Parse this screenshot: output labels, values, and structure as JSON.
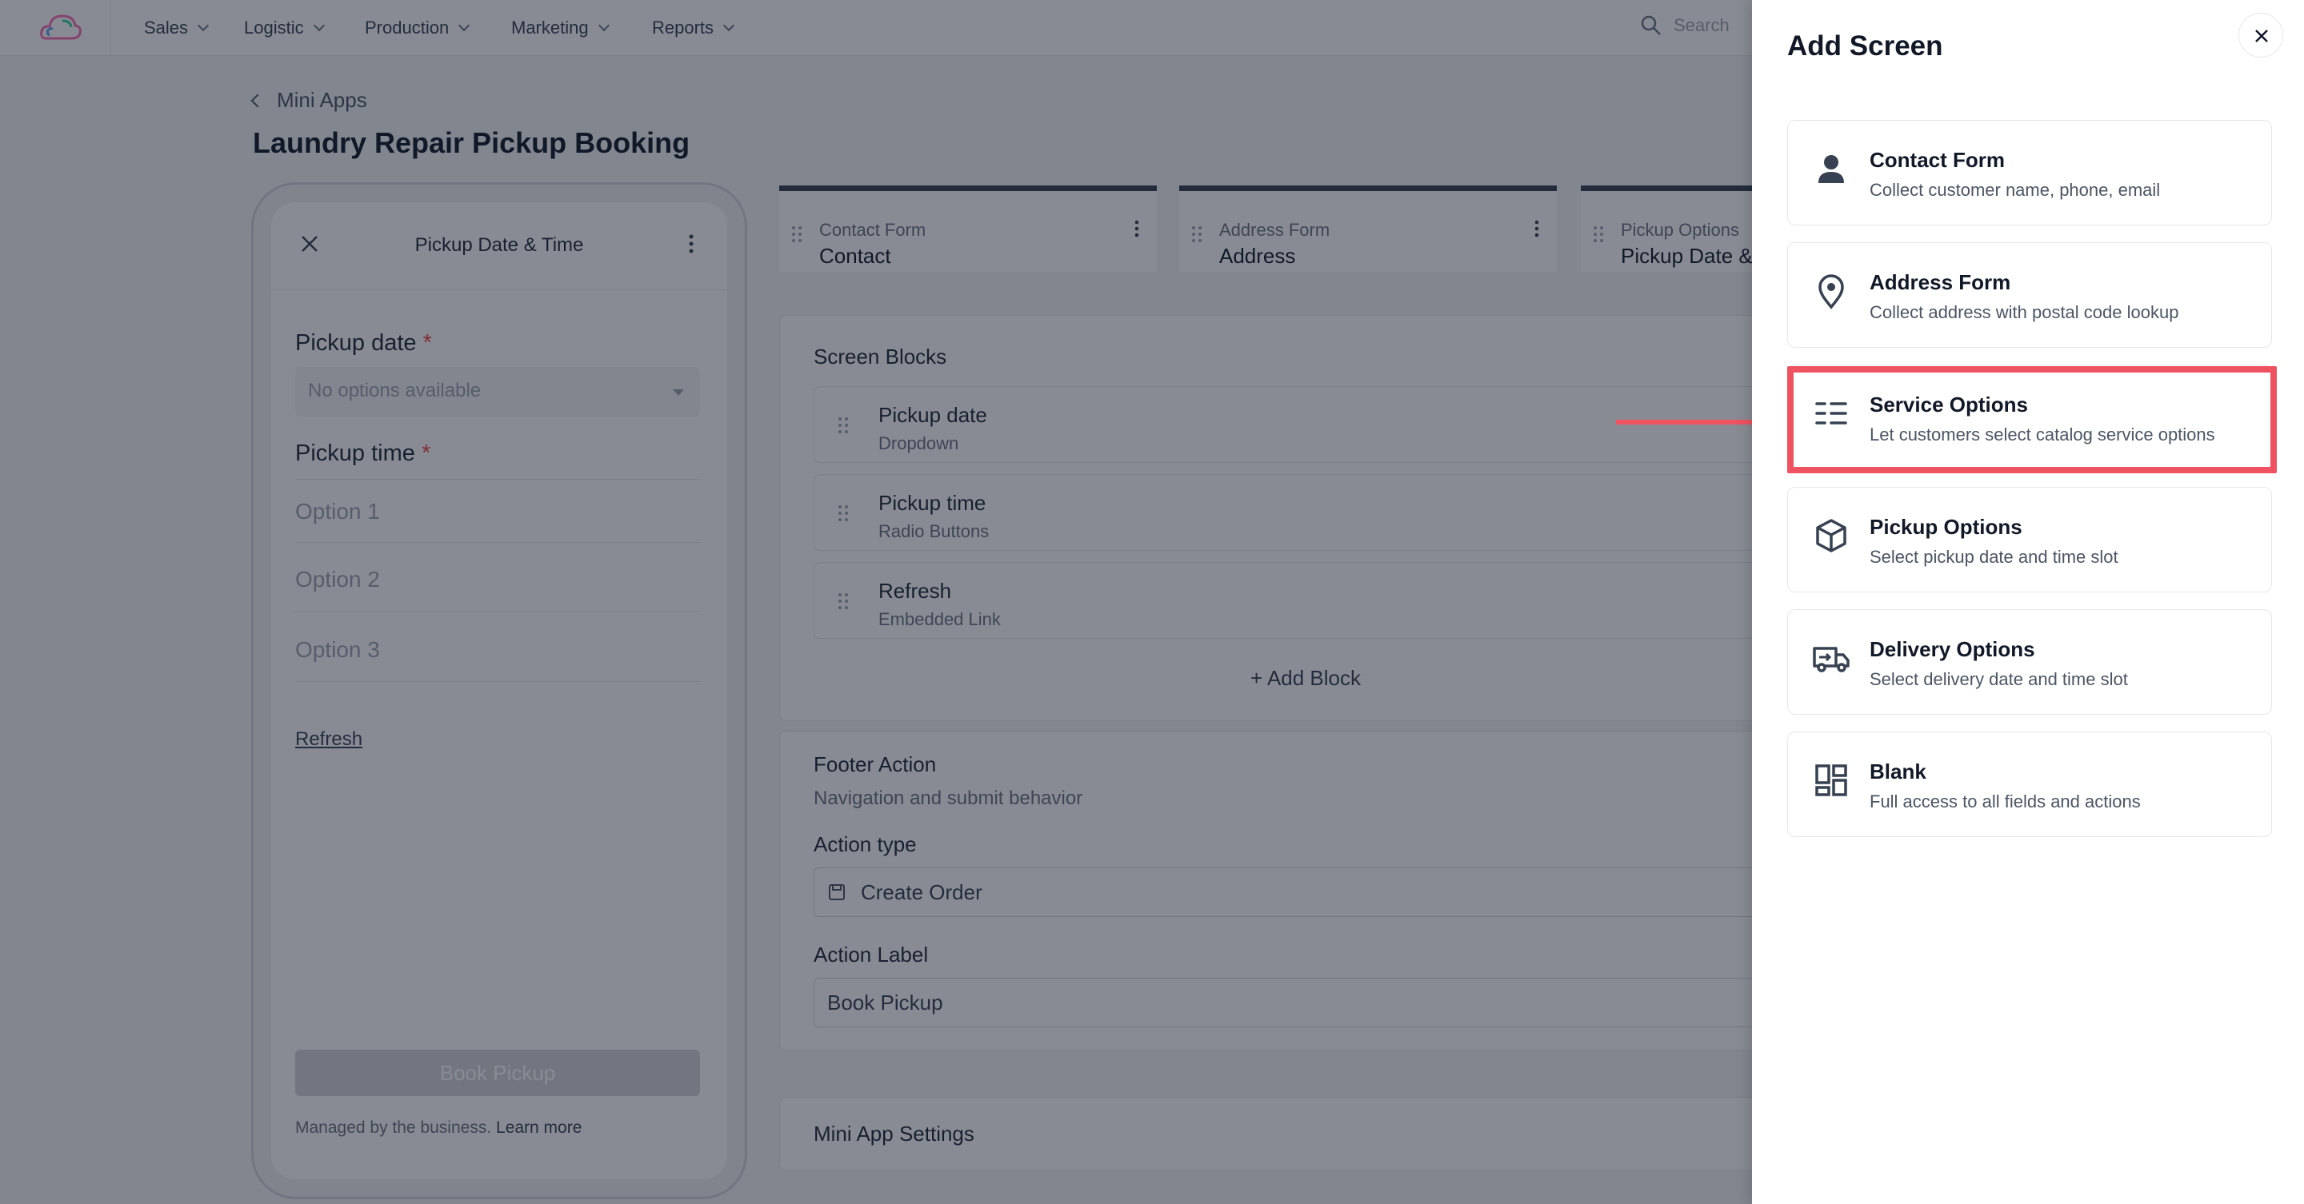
{
  "topnav": {
    "items": [
      {
        "label": "Sales"
      },
      {
        "label": "Logistic"
      },
      {
        "label": "Production"
      },
      {
        "label": "Marketing"
      },
      {
        "label": "Reports"
      }
    ],
    "search_placeholder": "Search"
  },
  "breadcrumb": {
    "label": "Mini Apps"
  },
  "page": {
    "title": "Laundry Repair Pickup Booking"
  },
  "phone": {
    "header_title": "Pickup Date & Time",
    "pickup_date_label": "Pickup date",
    "required_mark": "*",
    "pickup_date_placeholder": "No options available",
    "pickup_time_label": "Pickup time",
    "options": [
      "Option 1",
      "Option 2",
      "Option 3"
    ],
    "refresh_link": "Refresh",
    "book_button": "Book Pickup",
    "managed_text": "Managed by the business.",
    "learn_more": "Learn more"
  },
  "screens": [
    {
      "subtitle": "Contact Form",
      "title": "Contact"
    },
    {
      "subtitle": "Address Form",
      "title": "Address"
    },
    {
      "subtitle": "Pickup Options",
      "title": "Pickup Date &"
    }
  ],
  "screen_blocks": {
    "title": "Screen Blocks",
    "blocks": [
      {
        "name": "Pickup date",
        "type": "Dropdown"
      },
      {
        "name": "Pickup time",
        "type": "Radio Buttons"
      },
      {
        "name": "Refresh",
        "type": "Embedded Link"
      }
    ],
    "add_block": "+  Add Block"
  },
  "footer_action": {
    "title": "Footer Action",
    "subtitle": "Navigation and submit behavior",
    "action_type_label": "Action type",
    "action_type_value": "Create Order",
    "action_label_label": "Action Label",
    "action_label_value": "Book Pickup"
  },
  "settings": {
    "title": "Mini App Settings"
  },
  "drawer": {
    "title": "Add Screen",
    "options": [
      {
        "title": "Contact Form",
        "desc": "Collect customer name, phone, email",
        "icon": "person-icon"
      },
      {
        "title": "Address Form",
        "desc": "Collect address with postal code lookup",
        "icon": "map-pin-icon"
      },
      {
        "title": "Service Options",
        "desc": "Let customers select catalog service options",
        "icon": "list-icon"
      },
      {
        "title": "Pickup Options",
        "desc": "Select pickup date and time slot",
        "icon": "box-icon"
      },
      {
        "title": "Delivery Options",
        "desc": "Select delivery date and time slot",
        "icon": "truck-icon"
      },
      {
        "title": "Blank",
        "desc": "Full access to all fields and actions",
        "icon": "dashboard-icon"
      }
    ]
  },
  "colors": {
    "highlight": "#ef5261",
    "overlay": "rgba(17,24,39,0.5)"
  }
}
